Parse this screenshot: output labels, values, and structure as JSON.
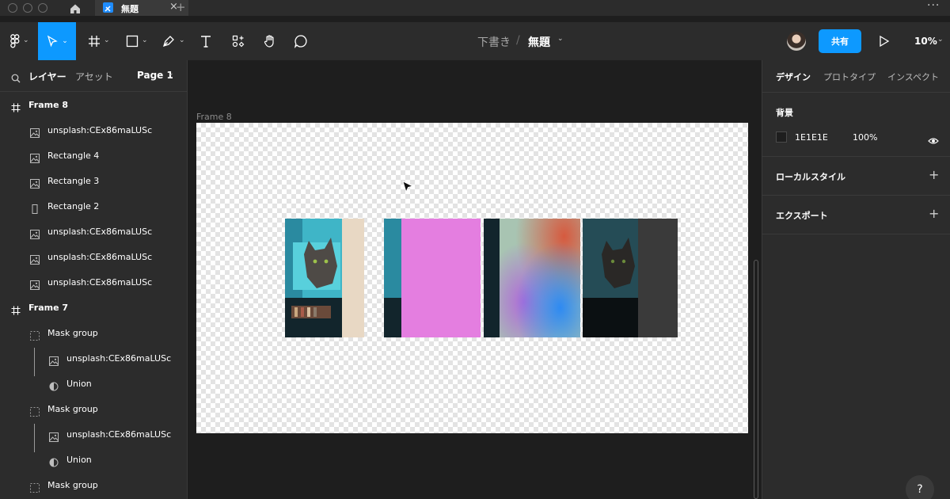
{
  "window": {
    "tab_title": "無題",
    "close_glyph": "×",
    "add_glyph": "+",
    "more_glyph": "···"
  },
  "toolbar": {
    "breadcrumb_draft": "下書き",
    "breadcrumb_sep": "/",
    "file_title": "無題",
    "share_label": "共有",
    "zoom": "10%",
    "icons": [
      "figma-menu-icon",
      "move-tool-icon",
      "frame-tool-icon",
      "shape-tool-icon",
      "pen-tool-icon",
      "text-tool-icon",
      "resources-icon",
      "hand-tool-icon",
      "comment-icon"
    ]
  },
  "left_panel": {
    "tab_layers": "レイヤー",
    "tab_assets": "アセット",
    "page": "Page 1",
    "layers": [
      {
        "label": "Frame 8",
        "icon": "frame-icon",
        "indent": 0
      },
      {
        "label": "unsplash:CEx86maLUSc",
        "icon": "image-icon",
        "indent": 1
      },
      {
        "label": "Rectangle 4",
        "icon": "image-icon",
        "indent": 1
      },
      {
        "label": "Rectangle 3",
        "icon": "image-icon",
        "indent": 1
      },
      {
        "label": "Rectangle 2",
        "icon": "rectangle-icon",
        "indent": 1
      },
      {
        "label": "unsplash:CEx86maLUSc",
        "icon": "image-icon",
        "indent": 1
      },
      {
        "label": "unsplash:CEx86maLUSc",
        "icon": "image-icon",
        "indent": 1
      },
      {
        "label": "unsplash:CEx86maLUSc",
        "icon": "image-icon",
        "indent": 1
      },
      {
        "label": "Frame 7",
        "icon": "frame-icon",
        "indent": 0
      },
      {
        "label": "Mask group",
        "icon": "mask-group-icon",
        "indent": 1
      },
      {
        "label": "unsplash:CEx86maLUSc",
        "icon": "image-icon",
        "indent": 2
      },
      {
        "label": "Union",
        "icon": "union-icon",
        "indent": 2
      },
      {
        "label": "Mask group",
        "icon": "mask-group-icon",
        "indent": 1
      },
      {
        "label": "unsplash:CEx86maLUSc",
        "icon": "image-icon",
        "indent": 2
      },
      {
        "label": "Union",
        "icon": "union-icon",
        "indent": 2
      },
      {
        "label": "Mask group",
        "icon": "mask-group-icon",
        "indent": 1
      }
    ]
  },
  "canvas": {
    "frame_label": "Frame 8",
    "thumbnails": [
      "cat-photo-crop",
      "pink-rectangle",
      "gradient-rectangle",
      "dark-cat-photo"
    ]
  },
  "right_panel": {
    "tab_design": "デザイン",
    "tab_prototype": "プロトタイプ",
    "tab_inspect": "インスペクト",
    "background_title": "背景",
    "background_hex": "1E1E1E",
    "background_opacity": "100%",
    "local_styles": "ローカルスタイル",
    "export": "エクスポート",
    "plus_glyph": "+",
    "help_glyph": "?"
  },
  "colors": {
    "accent": "#0d99ff",
    "panel": "#2c2c2c",
    "canvas": "#1e1e1e",
    "pink": "#e47ee0"
  }
}
